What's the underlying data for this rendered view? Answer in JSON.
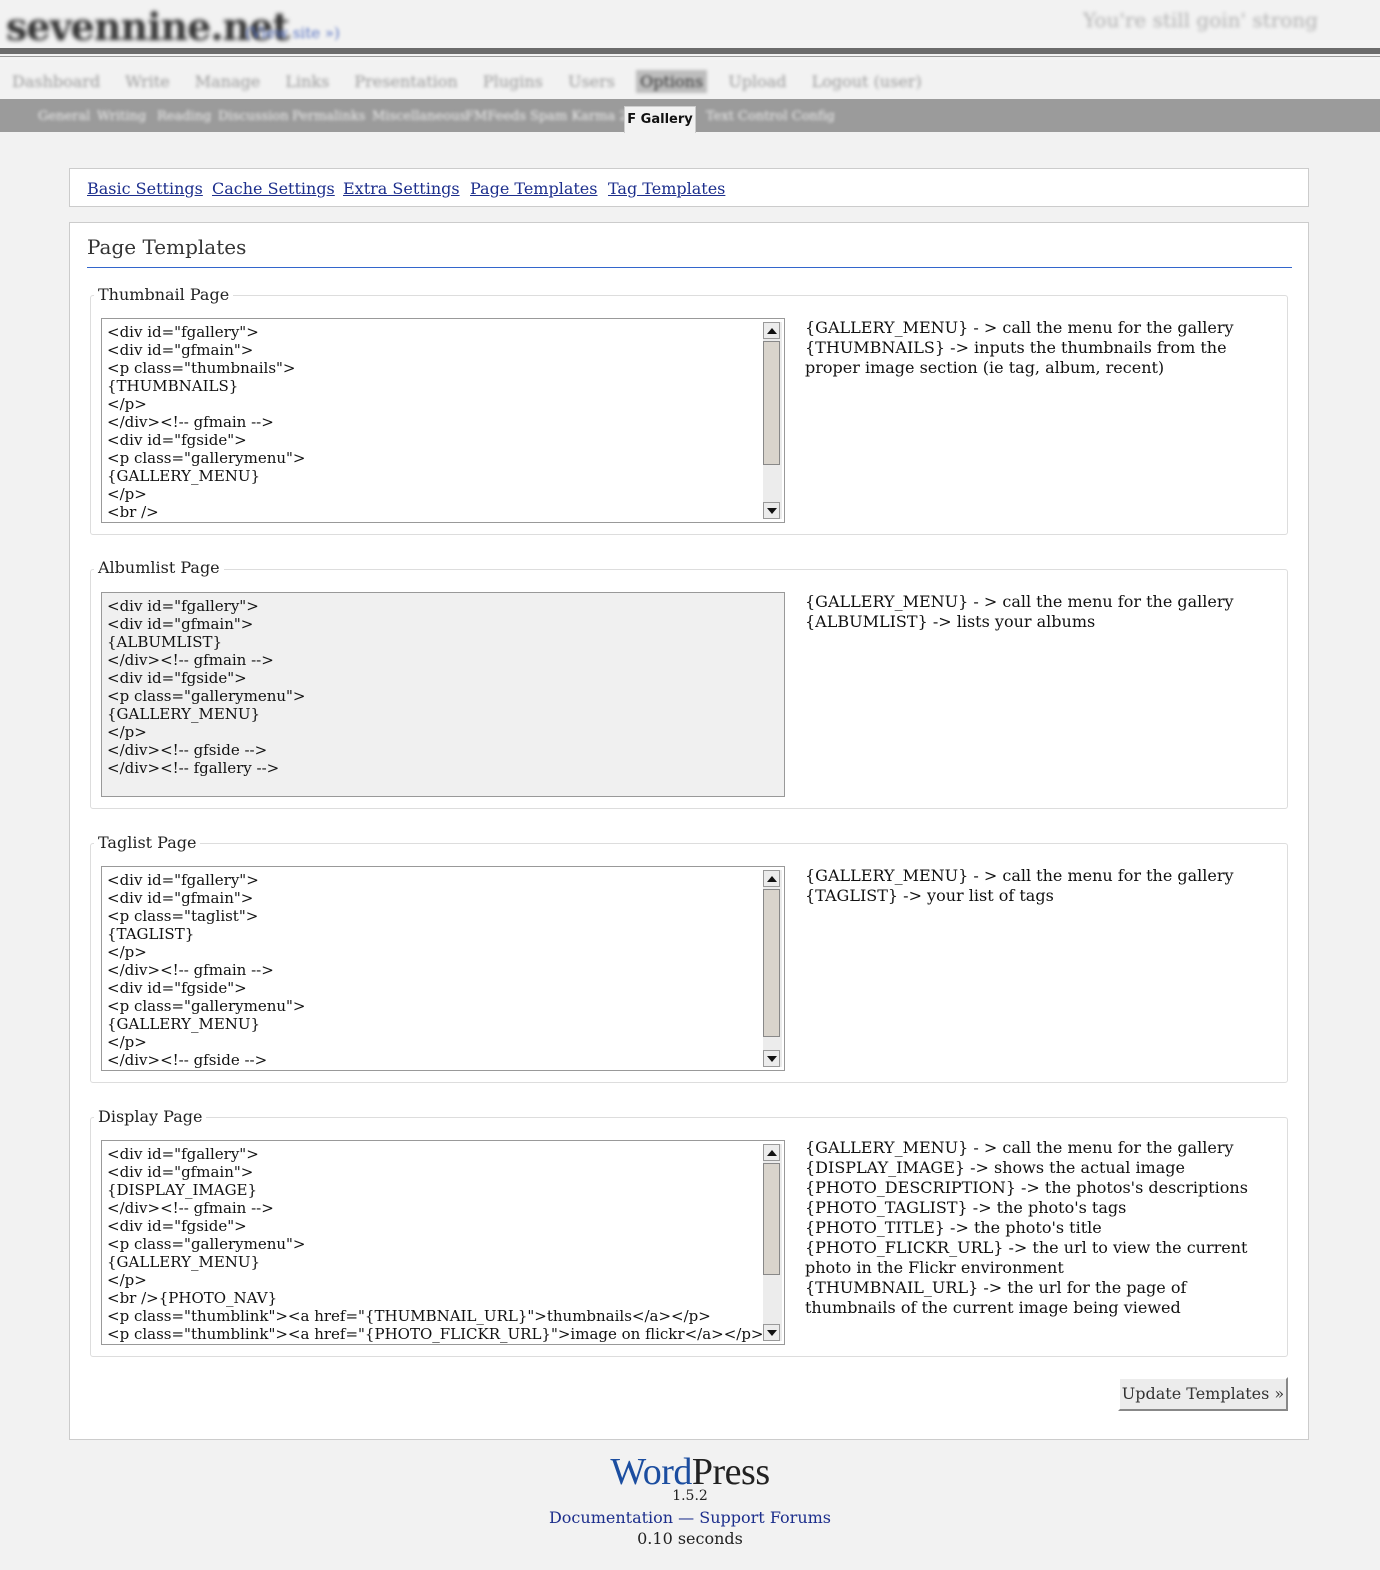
{
  "header": {
    "site_title": "sevennine.net",
    "view_site": "(View site »)",
    "quote": "You're still goin' strong"
  },
  "admin_menu": [
    "Dashboard",
    "Write",
    "Manage",
    "Links",
    "Presentation",
    "Plugins",
    "Users",
    "Options",
    "Upload",
    "Logout (user)"
  ],
  "admin_menu_current": "Options",
  "sub_menu": [
    "General",
    "Writing",
    "Reading",
    "Discussion",
    "Permalinks",
    "Miscellaneous",
    "FMFeeds",
    "Spam Karma 2",
    "Text Control Config"
  ],
  "sub_menu_current": "F Gallery",
  "tabs": [
    "Basic Settings",
    "Cache Settings",
    "Extra Settings",
    "Page Templates",
    "Tag Templates"
  ],
  "page_title": "Page Templates",
  "sections": [
    {
      "title": "Thumbnail Page",
      "code": "<div id=\"fgallery\">\n<div id=\"gfmain\">\n<p class=\"thumbnails\">\n{THUMBNAILS}\n</p>\n</div><!-- gfmain -->\n<div id=\"fgside\">\n<p class=\"gallerymenu\">\n{GALLERY_MENU}\n</p>\n<br />",
      "desc": "{GALLERY_MENU} - > call the menu for the gallery\n{THUMBNAILS} -> inputs the thumbnails from the proper image section (ie tag, album, recent)"
    },
    {
      "title": "Albumlist Page",
      "code": "<div id=\"fgallery\">\n<div id=\"gfmain\">\n{ALBUMLIST}\n</div><!-- gfmain -->\n<div id=\"fgside\">\n<p class=\"gallerymenu\">\n{GALLERY_MENU}\n</p>\n</div><!-- gfside -->\n</div><!-- fgallery -->",
      "desc": "{GALLERY_MENU} - > call the menu for the gallery\n{ALBUMLIST} -> lists your albums"
    },
    {
      "title": "Taglist Page",
      "code": "<div id=\"fgallery\">\n<div id=\"gfmain\">\n<p class=\"taglist\">\n{TAGLIST}\n</p>\n</div><!-- gfmain -->\n<div id=\"fgside\">\n<p class=\"gallerymenu\">\n{GALLERY_MENU}\n</p>\n</div><!-- gfside -->",
      "desc": "{GALLERY_MENU} - > call the menu for the gallery\n{TAGLIST} -> your list of tags"
    },
    {
      "title": "Display Page",
      "code": "<div id=\"fgallery\">\n<div id=\"gfmain\">\n{DISPLAY_IMAGE}\n</div><!-- gfmain -->\n<div id=\"fgside\">\n<p class=\"gallerymenu\">\n{GALLERY_MENU}\n</p>\n<br />{PHOTO_NAV}\n<p class=\"thumblink\"><a href=\"{THUMBNAIL_URL}\">thumbnails</a></p>\n<p class=\"thumblink\"><a href=\"{PHOTO_FLICKR_URL}\">image on flickr</a></p>",
      "desc": "{GALLERY_MENU} - > call the menu for the gallery\n{DISPLAY_IMAGE} -> shows the actual image\n{PHOTO_DESCRIPTION} -> the photos's descriptions\n{PHOTO_TAGLIST} -> the photo's tags\n{PHOTO_TITLE} -> the photo's title\n{PHOTO_FLICKR_URL} -> the url to view the current photo in the Flickr environment\n{THUMBNAIL_URL} -> the url for the page of thumbnails of the current image being viewed"
    }
  ],
  "update_button": "Update Templates »",
  "footer": {
    "logo_word": "Word",
    "logo_press": "Press",
    "version": "1.5.2",
    "doc_link": "Documentation",
    "separator": " — ",
    "forum_link": "Support Forums",
    "time": "0.10 seconds"
  }
}
